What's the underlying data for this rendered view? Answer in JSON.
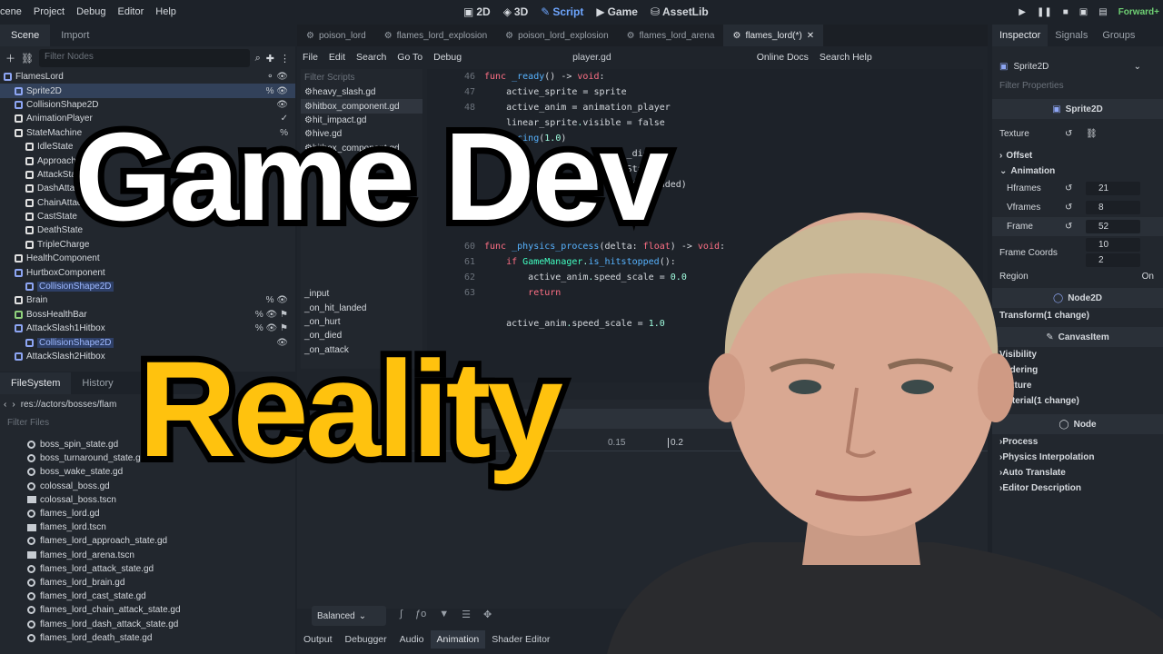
{
  "topbar": {
    "menus": [
      "cene",
      "Project",
      "Debug",
      "Editor",
      "Help"
    ],
    "modes": [
      {
        "label": "2D"
      },
      {
        "label": "3D"
      },
      {
        "label": "Script",
        "active": true
      },
      {
        "label": "Game"
      },
      {
        "label": "AssetLib"
      }
    ],
    "renderer": "Forward+"
  },
  "scene_dock": {
    "tabs": [
      "Scene",
      "Import"
    ],
    "filter_placeholder": "Filter Nodes",
    "nodes": [
      {
        "label": "FlamesLord",
        "depth": 0,
        "color": "#8da5f3",
        "right": "⚬ 👁"
      },
      {
        "label": "Sprite2D",
        "depth": 1,
        "color": "#8da5f3",
        "right": "% 👁",
        "selected": true
      },
      {
        "label": "CollisionShape2D",
        "depth": 1,
        "color": "#8da5f3",
        "right": "👁"
      },
      {
        "label": "AnimationPlayer",
        "depth": 1,
        "color": "#e0e0e0",
        "right": "✓"
      },
      {
        "label": "StateMachine",
        "depth": 1,
        "color": "#e0e0e0",
        "right": "%"
      },
      {
        "label": "IdleState",
        "depth": 2,
        "color": "#e0e0e0",
        "right": ""
      },
      {
        "label": "ApproachState",
        "depth": 2,
        "color": "#e0e0e0",
        "right": ""
      },
      {
        "label": "AttackState",
        "depth": 2,
        "color": "#e0e0e0",
        "right": ""
      },
      {
        "label": "DashAttackState",
        "depth": 2,
        "color": "#e0e0e0",
        "right": ""
      },
      {
        "label": "ChainAttackState",
        "depth": 2,
        "color": "#e0e0e0",
        "right": ""
      },
      {
        "label": "CastState",
        "depth": 2,
        "color": "#e0e0e0",
        "right": ""
      },
      {
        "label": "DeathState",
        "depth": 2,
        "color": "#e0e0e0",
        "right": ""
      },
      {
        "label": "TripleCharge",
        "depth": 2,
        "color": "#e0e0e0",
        "right": ""
      },
      {
        "label": "HealthComponent",
        "depth": 1,
        "color": "#e0e0e0",
        "right": ""
      },
      {
        "label": "HurtboxComponent",
        "depth": 1,
        "color": "#8da5f3",
        "right": ""
      },
      {
        "label": "CollisionShape2D",
        "depth": 2,
        "color": "#8da5f3",
        "right": "",
        "blue": true
      },
      {
        "label": "Brain",
        "depth": 1,
        "color": "#e0e0e0",
        "right": "% 👁"
      },
      {
        "label": "BossHealthBar",
        "depth": 1,
        "color": "#8fd17c",
        "right": "% 👁 ⚑"
      },
      {
        "label": "AttackSlash1Hitbox",
        "depth": 1,
        "color": "#8da5f3",
        "right": "% 👁 ⚑"
      },
      {
        "label": "CollisionShape2D",
        "depth": 2,
        "color": "#8da5f3",
        "right": "👁",
        "blue": true
      },
      {
        "label": "AttackSlash2Hitbox",
        "depth": 1,
        "color": "#8da5f3",
        "right": ""
      }
    ]
  },
  "fs_dock": {
    "tabs": [
      "FileSystem",
      "History"
    ],
    "path": "res://actors/bosses/flam",
    "filter_placeholder": "Filter Files",
    "files": [
      {
        "name": "boss_spin_state.gd",
        "kind": "gd"
      },
      {
        "name": "boss_turnaround_state.gd",
        "kind": "gd"
      },
      {
        "name": "boss_wake_state.gd",
        "kind": "gd"
      },
      {
        "name": "colossal_boss.gd",
        "kind": "gd"
      },
      {
        "name": "colossal_boss.tscn",
        "kind": "tscn"
      },
      {
        "name": "flames_lord.gd",
        "kind": "gd"
      },
      {
        "name": "flames_lord.tscn",
        "kind": "tscn"
      },
      {
        "name": "flames_lord_approach_state.gd",
        "kind": "gd"
      },
      {
        "name": "flames_lord_arena.tscn",
        "kind": "tscn"
      },
      {
        "name": "flames_lord_attack_state.gd",
        "kind": "gd"
      },
      {
        "name": "flames_lord_brain.gd",
        "kind": "gd"
      },
      {
        "name": "flames_lord_cast_state.gd",
        "kind": "gd"
      },
      {
        "name": "flames_lord_chain_attack_state.gd",
        "kind": "gd"
      },
      {
        "name": "flames_lord_dash_attack_state.gd",
        "kind": "gd"
      },
      {
        "name": "flames_lord_death_state.gd",
        "kind": "gd"
      }
    ]
  },
  "script_tabs": [
    {
      "label": "poison_lord"
    },
    {
      "label": "flames_lord_explosion"
    },
    {
      "label": "poison_lord_explosion"
    },
    {
      "label": "flames_lord_arena"
    },
    {
      "label": "flames_lord(*)",
      "active": true
    }
  ],
  "script_menu": {
    "items": [
      "File",
      "Edit",
      "Search",
      "Go To",
      "Debug"
    ],
    "file": "player.gd",
    "online_docs": "Online Docs",
    "search_help": "Search Help"
  },
  "script_list": {
    "filter_placeholder": "Filter Scripts",
    "items": [
      "heavy_slash.gd",
      "hitbox_component.gd",
      "hit_impact.gd",
      "hive.gd",
      "hitbox_component.gd"
    ],
    "methods": [
      "_input",
      "_on_hit_landed",
      "_on_hurt",
      "_on_died",
      "_on_attack"
    ]
  },
  "code_lines": [
    {
      "n": "46",
      "t": "func _ready() -> void:"
    },
    {
      "n": "47",
      "t": "    active_sprite = sprite"
    },
    {
      "n": "48",
      "t": "    active_anim = animation_player"
    },
    {
      "n": "",
      "t": "    linear_sprite.visible = false"
    },
    {
      "n": "",
      "t": "    facing(1.0)"
    },
    {
      "n": "",
      "t": "                          _died)"
    },
    {
      "n": "",
      "t": "                          State\")"
    },
    {
      "n": "",
      "t": "                          hit_landed)"
    },
    {
      "n": "",
      "t": ""
    },
    {
      "n": "",
      "t": "                          .0)"
    },
    {
      "n": "",
      "t": ""
    },
    {
      "n": "60",
      "t": "func _physics_process(delta: float) -> void:"
    },
    {
      "n": "61",
      "t": "    if GameManager.is_hitstopped():"
    },
    {
      "n": "62",
      "t": "        active_anim.speed_scale = 0.0"
    },
    {
      "n": "63",
      "t": "        return"
    },
    {
      "n": "",
      "t": ""
    },
    {
      "n": "",
      "t": "    active_anim.speed_scale = 1.0"
    }
  ],
  "timeline": {
    "ticks": [
      "0.15",
      "0.2"
    ]
  },
  "bottom_panel": {
    "balanced": "Balanced",
    "tabs": [
      "Output",
      "Debugger",
      "Audio",
      "Animation",
      "Shader Editor"
    ],
    "active_tab": "Animation"
  },
  "inspector": {
    "tabs": [
      "Inspector",
      "Signals",
      "Groups"
    ],
    "node_type": "Sprite2D",
    "filter_placeholder": "Filter Properties",
    "section_sprite": "Sprite2D",
    "texture_label": "Texture",
    "offset_label": "Offset",
    "animation_label": "Animation",
    "props": [
      {
        "label": "Hframes",
        "value": "21"
      },
      {
        "label": "Vframes",
        "value": "8"
      },
      {
        "label": "Frame",
        "value": "52"
      }
    ],
    "frame_coords_label": "Frame Coords",
    "frame_coords_x": "10",
    "frame_coords_y": "2",
    "region_label": "Region",
    "region_value": "On",
    "section_node2d": "Node2D",
    "transform_label": "Transform",
    "transform_change": "(1 change)",
    "section_canvasitem": "CanvasItem",
    "canvas_rows": [
      "Visibility",
      "Ordering",
      "Texture",
      "Material"
    ],
    "material_change": "(1 change)",
    "section_node": "Node",
    "node_rows": [
      "Process",
      "Physics Interpolation",
      "Auto Translate",
      "Editor Description"
    ]
  },
  "overlay": {
    "line1": "Game Dev",
    "line2": "Reality",
    "line1_color": "#ffffff",
    "line2_color": "#ffc20e"
  }
}
